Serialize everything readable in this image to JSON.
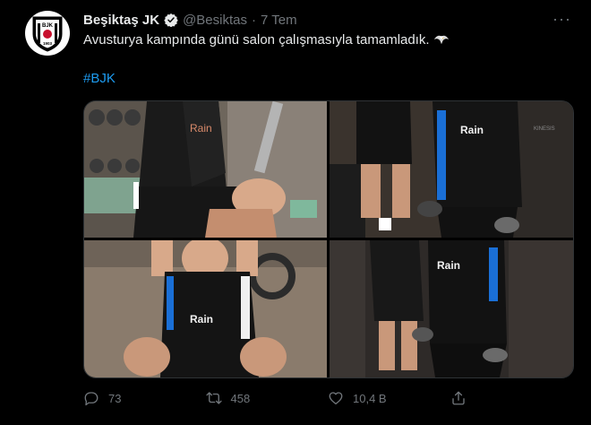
{
  "tweet": {
    "author_name": "Beşiktaş JK",
    "handle": "@Besiktas",
    "separator": "·",
    "time": "7 Tem",
    "text": "Avusturya kampında günü salon çalışmasıyla tamamladık.",
    "emoji": "eagle-emoji",
    "hashtag": "#BJK",
    "more": "···"
  },
  "avatar": {
    "logo_text": "BJK",
    "logo_year": "1903"
  },
  "media": {
    "photos": [
      {
        "sponsor": "Rain",
        "scene": "player-seated-gym"
      },
      {
        "sponsor": "Rain",
        "scene": "players-dumbbells"
      },
      {
        "sponsor": "Rain",
        "scene": "player-situps"
      },
      {
        "sponsor": "Rain",
        "scene": "players-dumbbells-side"
      }
    ],
    "wall_text": "KINESIS"
  },
  "actions": {
    "replies": "73",
    "retweets": "458",
    "likes": "10,4 B"
  },
  "colors": {
    "background": "#000000",
    "text": "#e7e9ea",
    "muted": "#71767b",
    "link": "#1d9bf0",
    "verified": "#1d9bf0"
  }
}
